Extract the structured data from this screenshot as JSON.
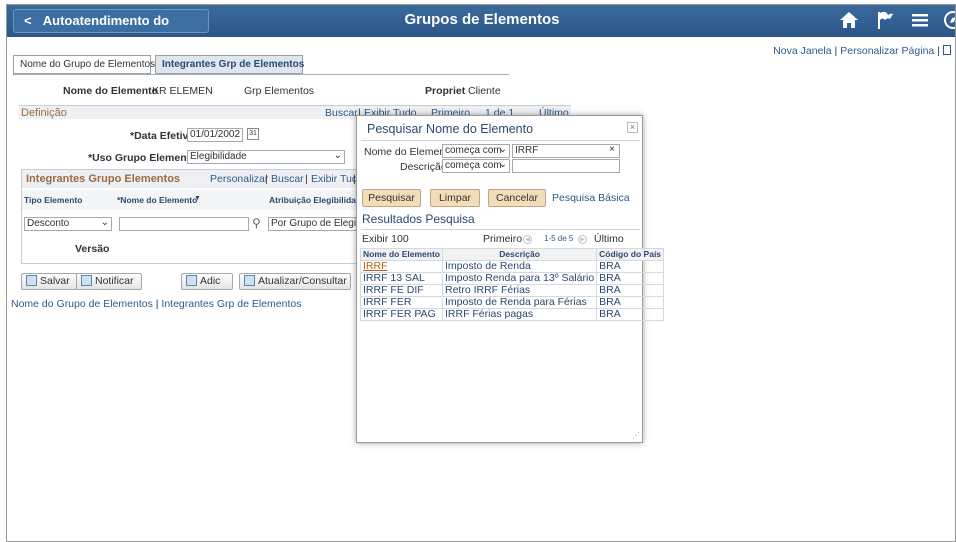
{
  "banner": {
    "home_label": "Autoatendimento do Gerente",
    "title": "Grupos de Elementos",
    "icons": [
      "home-icon",
      "flag-icon",
      "menu-icon",
      "navbar-icon"
    ]
  },
  "toplinks": {
    "new_window": "Nova Janela",
    "personalize": "Personalizar Página",
    "sep": "|"
  },
  "tabs": [
    {
      "label": "Nome do Grupo de Elementos",
      "active": false
    },
    {
      "label": "Integrantes Grp de Elementos",
      "active": true
    }
  ],
  "header": {
    "elem_name_label": "Nome do Elemento",
    "elem_name_value": "KR ELEMEN",
    "grp_label": "Grp Elementos",
    "owner_label": "Propriet",
    "owner_value": "Cliente"
  },
  "definition": {
    "title": "Definição",
    "nav": {
      "find": "Buscar",
      "sep": "|",
      "view_all": "Exibir Tudo",
      "first": "Primeiro",
      "counter": "1 de 1",
      "last": "Último"
    },
    "eff_date_label": "*Data Efetiva",
    "eff_date_value": "01/01/2002",
    "usage_label": "*Uso Grupo Elementos",
    "usage_value": "Elegibilidade"
  },
  "grid": {
    "title": "Integrantes Grupo Elementos",
    "personalize": "Personalizar",
    "find": "Buscar",
    "view_all": "Exibir Tudo",
    "sep": "|",
    "columns": [
      "Tipo Elemento",
      "*Nome do Elemento",
      "Atribuição Elegibilidade"
    ],
    "row": {
      "type": "Desconto",
      "name": "",
      "attr": "Por Grupo de Elegibilidade"
    },
    "version_label": "Versão"
  },
  "buttons": {
    "save": "Salvar",
    "notify": "Notificar",
    "add": "Adic",
    "update": "Atualizar/Consultar"
  },
  "footer_links": {
    "first": "Nome do Grupo de Elementos",
    "sep": "|",
    "second": "Integrantes Grp de Elementos"
  },
  "modal": {
    "title": "Pesquisar Nome do Elemento",
    "close": "×",
    "name_label": "Nome do Elemento",
    "name_op": "começa com",
    "name_value": "IRRF",
    "desc_label": "Descrição",
    "desc_op": "começa com",
    "desc_value": "",
    "btn_search": "Pesquisar",
    "btn_clear": "Limpar",
    "btn_cancel": "Cancelar",
    "basic_link": "Pesquisa Básica",
    "results_title": "Resultados Pesquisa",
    "view_100": "Exibir 100",
    "first": "Primeiro",
    "range": "1-5 de 5",
    "last": "Último",
    "columns": [
      "Nome do Elemento",
      "Descrição",
      "Código do País"
    ],
    "rows": [
      {
        "name": "IRRF",
        "desc": "Imposto de Renda",
        "country": "BRA"
      },
      {
        "name": "IRRF 13 SAL",
        "desc": "Imposto Renda para 13º Salário",
        "country": "BRA"
      },
      {
        "name": "IRRF FE DIF",
        "desc": "Retro IRRF Férias",
        "country": "BRA"
      },
      {
        "name": "IRRF FER",
        "desc": "Imposto de Renda para Férias",
        "country": "BRA"
      },
      {
        "name": "IRRF FER PAG",
        "desc": "IRRF Férias pagas",
        "country": "BRA"
      }
    ]
  }
}
